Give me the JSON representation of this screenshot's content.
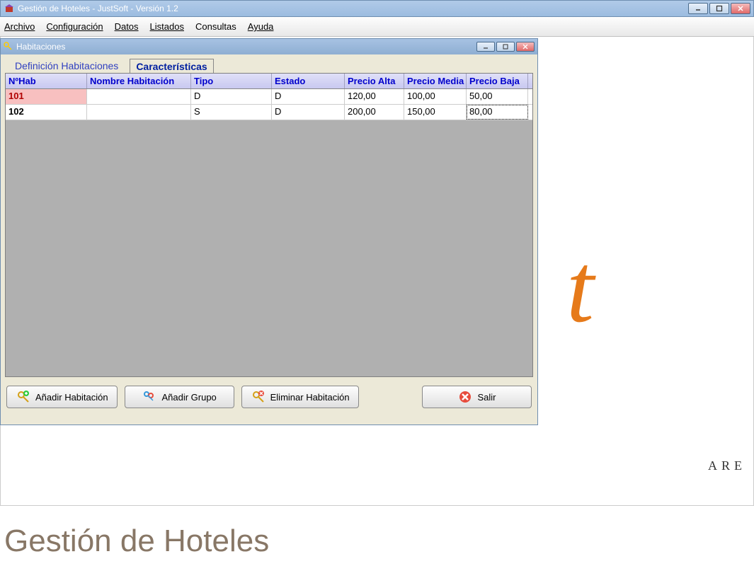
{
  "app": {
    "title": "Gestión de Hoteles - JustSoft - Versión 1.2"
  },
  "menubar": {
    "items": [
      "Archivo",
      "Configuración",
      "Datos",
      "Listados",
      "Consultas",
      "Ayuda"
    ]
  },
  "child": {
    "title": "Habitaciones"
  },
  "tabs": {
    "definicion": "Definición Habitaciones",
    "caracteristicas": "Características"
  },
  "grid": {
    "headers": {
      "nhab": "NºHab",
      "nombre": "Nombre Habitación",
      "tipo": "Tipo",
      "estado": "Estado",
      "alta": "Precio Alta",
      "media": "Precio Media",
      "baja": "Precio Baja"
    },
    "rows": [
      {
        "nhab": "101",
        "nombre": "",
        "tipo": "D",
        "estado": "D",
        "alta": "120,00",
        "media": "100,00",
        "baja": "50,00"
      },
      {
        "nhab": "102",
        "nombre": "",
        "tipo": "S",
        "estado": "D",
        "alta": "200,00",
        "media": "150,00",
        "baja": "80,00"
      }
    ]
  },
  "buttons": {
    "add_room": "Añadir Habitación",
    "add_group": "Añadir Grupo",
    "delete_room": "Eliminar Habitación",
    "exit": "Salir"
  },
  "branding": {
    "letters": "ARE",
    "footer": "Gestión de Hoteles"
  }
}
